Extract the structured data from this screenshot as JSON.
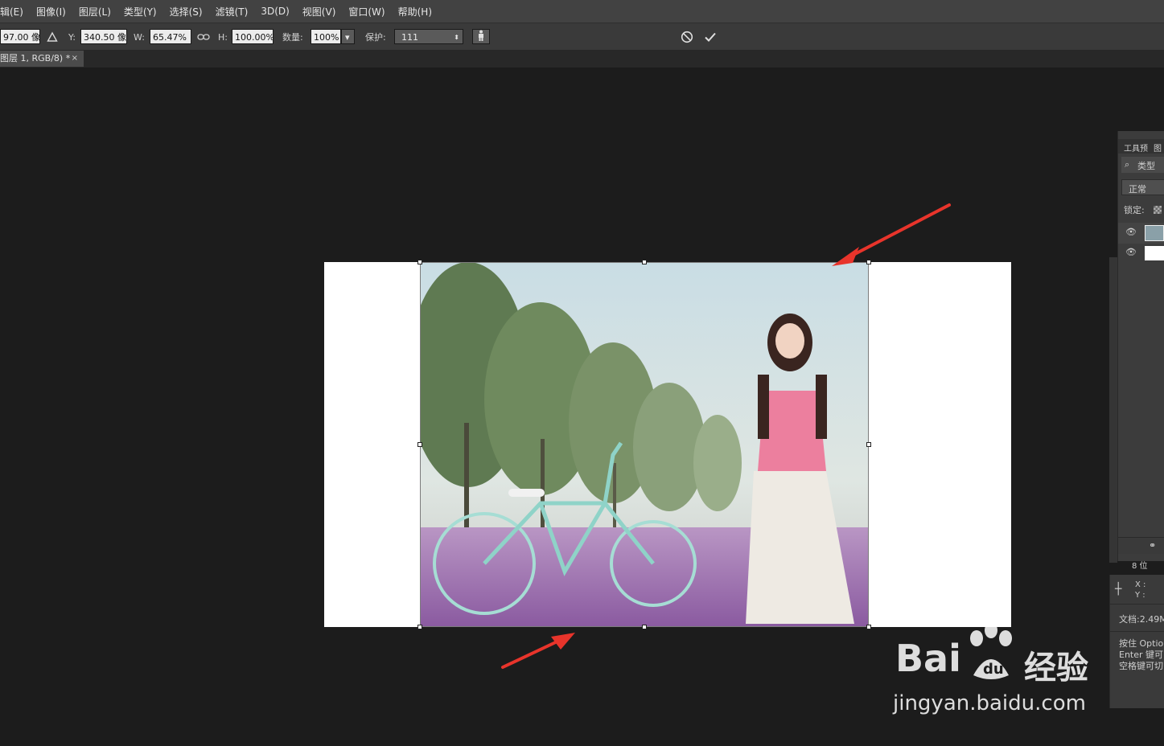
{
  "menubar": {
    "items": [
      "辑(E)",
      "图像(I)",
      "图层(L)",
      "类型(Y)",
      "选择(S)",
      "滤镜(T)",
      "3D(D)",
      "视图(V)",
      "窗口(W)",
      "帮助(H)"
    ]
  },
  "options": {
    "x_value": "97.00 像",
    "y_label": "Y:",
    "y_value": "340.50 像",
    "w_label": "W:",
    "w_value": "65.47%",
    "h_label": "H:",
    "h_value": "100.00%",
    "amount_label": "数量:",
    "amount_value": "100%",
    "protect_label": "保护:",
    "protect_value": "111"
  },
  "tab": {
    "title": "图层 1, RGB/8) *",
    "close": "×"
  },
  "layers_panel": {
    "tab1": "工具预",
    "tab2": "图",
    "search_placeholder": "类型",
    "blend_mode": "正常",
    "lock_label": "锁定:",
    "bit_depth": "8 位"
  },
  "info_panel": {
    "x_label": "X :",
    "y_label": "Y :",
    "doc_size": "文档:2.49M",
    "hint_line1": "按住 Option",
    "hint_line2": "Enter 键可",
    "hint_line3": "空格键可切"
  },
  "watermark": {
    "brand": "Bai",
    "brand2": "经验",
    "url": "jingyan.baidu.com"
  },
  "colors": {
    "accent_arrow": "#e8342b",
    "menubar": "#424242",
    "canvas_bg": "#1c1c1c"
  }
}
